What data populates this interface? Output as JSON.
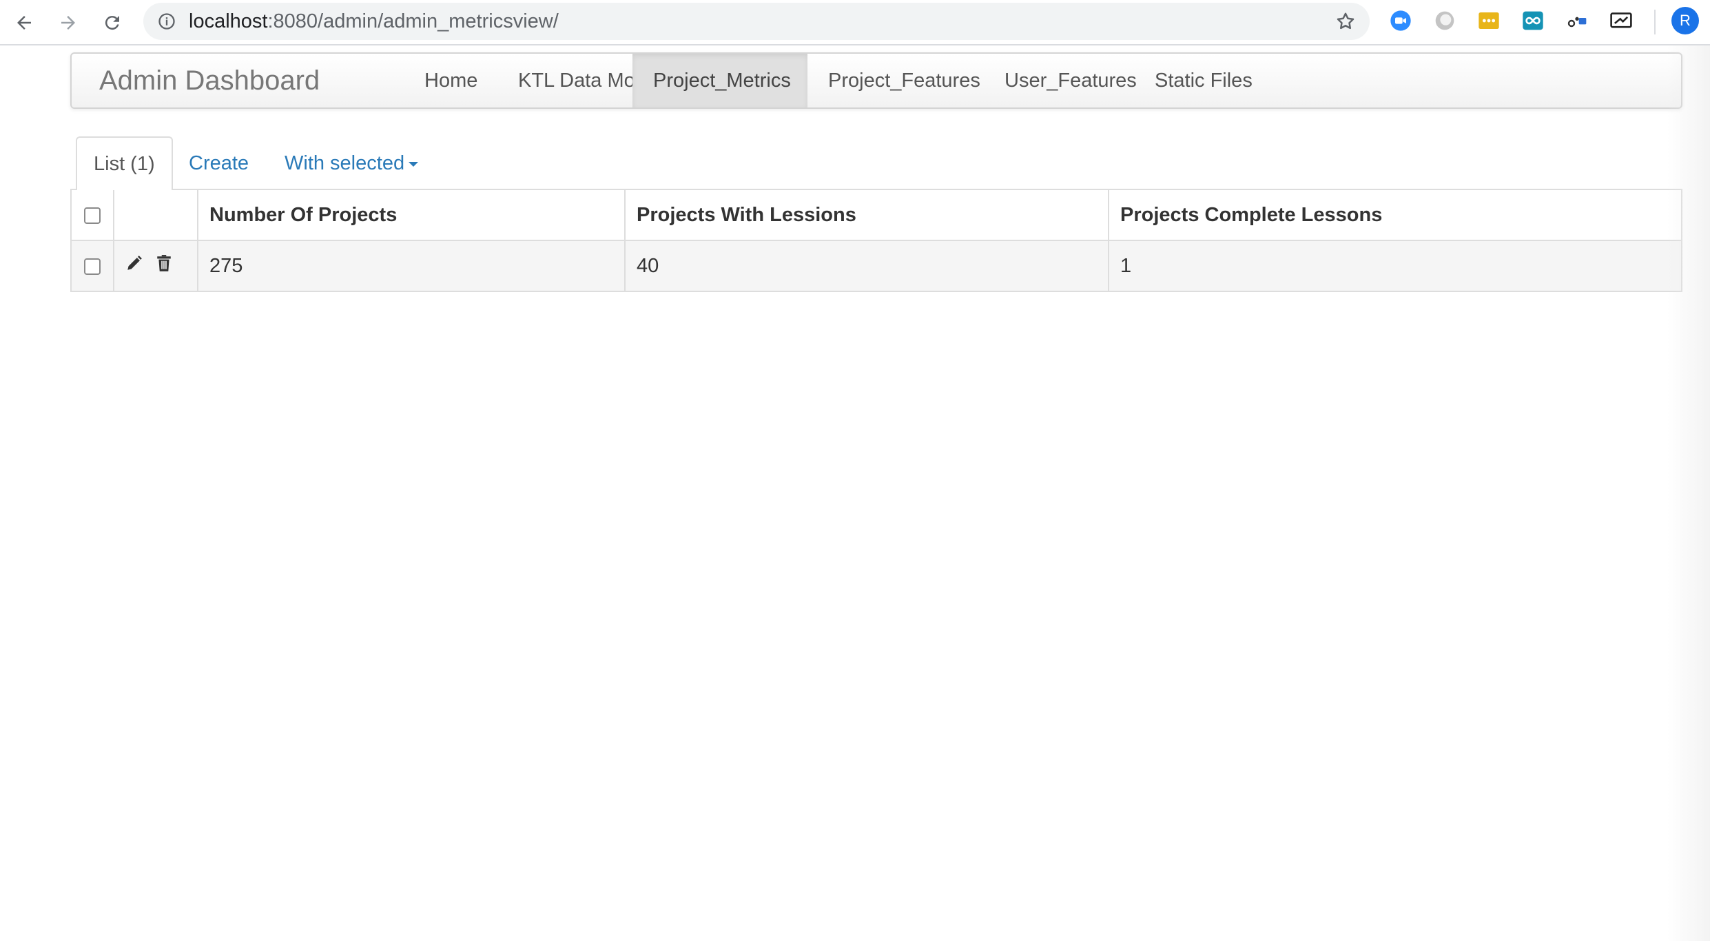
{
  "browser": {
    "url_host": "localhost",
    "url_path": ":8080/admin/admin_metricsview/",
    "profile_initial": "R",
    "extensions": [
      "video-camera-icon",
      "circle-icon",
      "dots-icon",
      "infinity-icon",
      "network-icon",
      "screen-cast-icon"
    ]
  },
  "navbar": {
    "brand": "Admin Dashboard",
    "items": [
      {
        "label": "Home"
      },
      {
        "label": "KTL Data Models",
        "dropdown": true
      },
      {
        "label": "Project_Metrics",
        "active": true
      },
      {
        "label": "Project_Features"
      },
      {
        "label": "User_Features"
      },
      {
        "label": "Static Files"
      }
    ]
  },
  "tabs": {
    "list": "List (1)",
    "create": "Create",
    "with_selected": "With selected"
  },
  "table": {
    "columns": [
      "Number Of Projects",
      "Projects With Lessions",
      "Projects Complete Lessons"
    ],
    "rows": [
      [
        "275",
        "40",
        "1"
      ]
    ]
  },
  "colors": {
    "link": "#2a7ab8",
    "active_tab_bg": "#e0e0e0",
    "row_bg": "#f5f5f5",
    "profile": "#1a73e8"
  }
}
